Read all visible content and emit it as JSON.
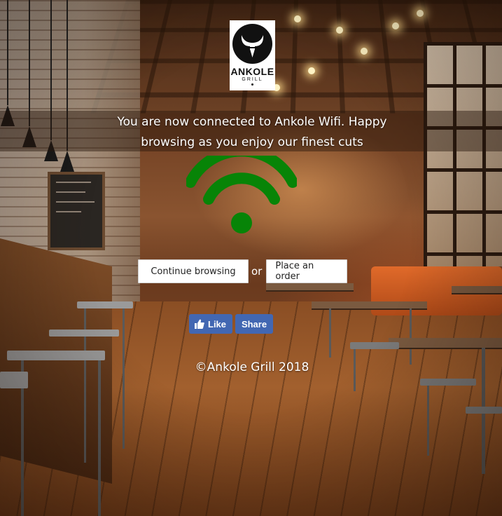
{
  "background": {
    "description_icon": "restaurant-interior-photo",
    "accent_colors": [
      "#6e3e22",
      "#a2602e",
      "#e06a2a"
    ]
  },
  "logo": {
    "name": "ANKOLE",
    "sub": "GRILL",
    "icon": "bull-horns-icon"
  },
  "headline": {
    "line1": "You are now connected to Ankole Wifi. Happy",
    "line2": "browsing as you enjoy our finest cuts"
  },
  "wifi": {
    "icon": "wifi-icon",
    "color": "#078407"
  },
  "actions": {
    "continue_label": "Continue browsing",
    "or_label": "or",
    "order_label": "Place an order"
  },
  "facebook": {
    "like_label": "Like",
    "share_label": "Share",
    "color": "#4267b2"
  },
  "footer": {
    "copyright": "©Ankole Grill 2018"
  }
}
